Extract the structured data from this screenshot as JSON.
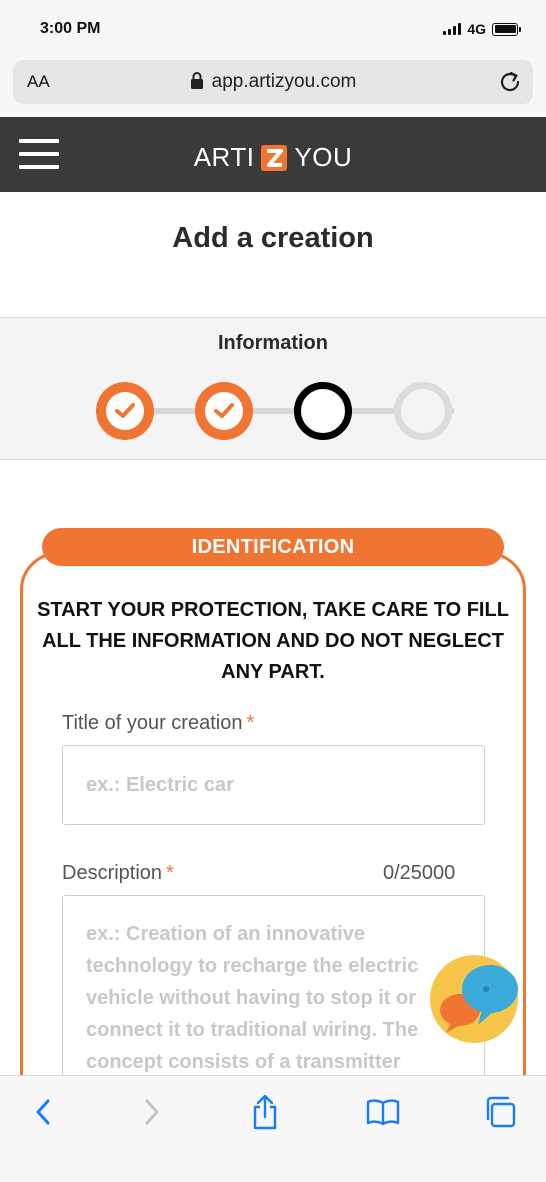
{
  "status_bar": {
    "time": "3:00 PM",
    "network": "4G",
    "icons": [
      "signal-icon",
      "battery-icon"
    ]
  },
  "browser": {
    "text_size_label": "AA",
    "url": "app.artizyou.com",
    "icons": [
      "lock-icon",
      "reload-icon"
    ]
  },
  "header": {
    "menu_icon": "hamburger-menu-icon",
    "logo_left": "ARTI",
    "logo_right": "YOU",
    "logo_letter": "Z"
  },
  "page": {
    "title": "Add a creation"
  },
  "stepper": {
    "title": "Information",
    "steps": [
      {
        "state": "done"
      },
      {
        "state": "done"
      },
      {
        "state": "current"
      },
      {
        "state": "todo"
      }
    ],
    "colors": {
      "done": "#f07533",
      "current": "#000000",
      "todo": "#dcdcdc"
    }
  },
  "identification": {
    "banner": "IDENTIFICATION",
    "intro": "START YOUR PROTECTION, TAKE CARE TO FILL ALL THE INFORMATION AND DO NOT NEGLECT ANY PART.",
    "title_field": {
      "label": "Title of your creation",
      "required_mark": "*",
      "placeholder": "ex.: Electric car",
      "value": ""
    },
    "description_field": {
      "label": "Description",
      "required_mark": "*",
      "counter": "0/25000",
      "placeholder_lines": [
        "ex.: Creation of an innovative",
        "technology to recharge the electric",
        "vehicle without having to stop it or",
        "connect it to traditional wiring. The",
        "concept consists of a transmitter"
      ],
      "value": ""
    }
  },
  "chat": {
    "icon": "chat-bubbles-icon"
  },
  "toolbar": {
    "icons": [
      "back-icon",
      "forward-icon",
      "share-icon",
      "bookmarks-icon",
      "tabs-icon"
    ]
  },
  "colors": {
    "accent": "#f07533",
    "header_bg": "#3a3a3a",
    "link_blue": "#1a7cf5"
  }
}
